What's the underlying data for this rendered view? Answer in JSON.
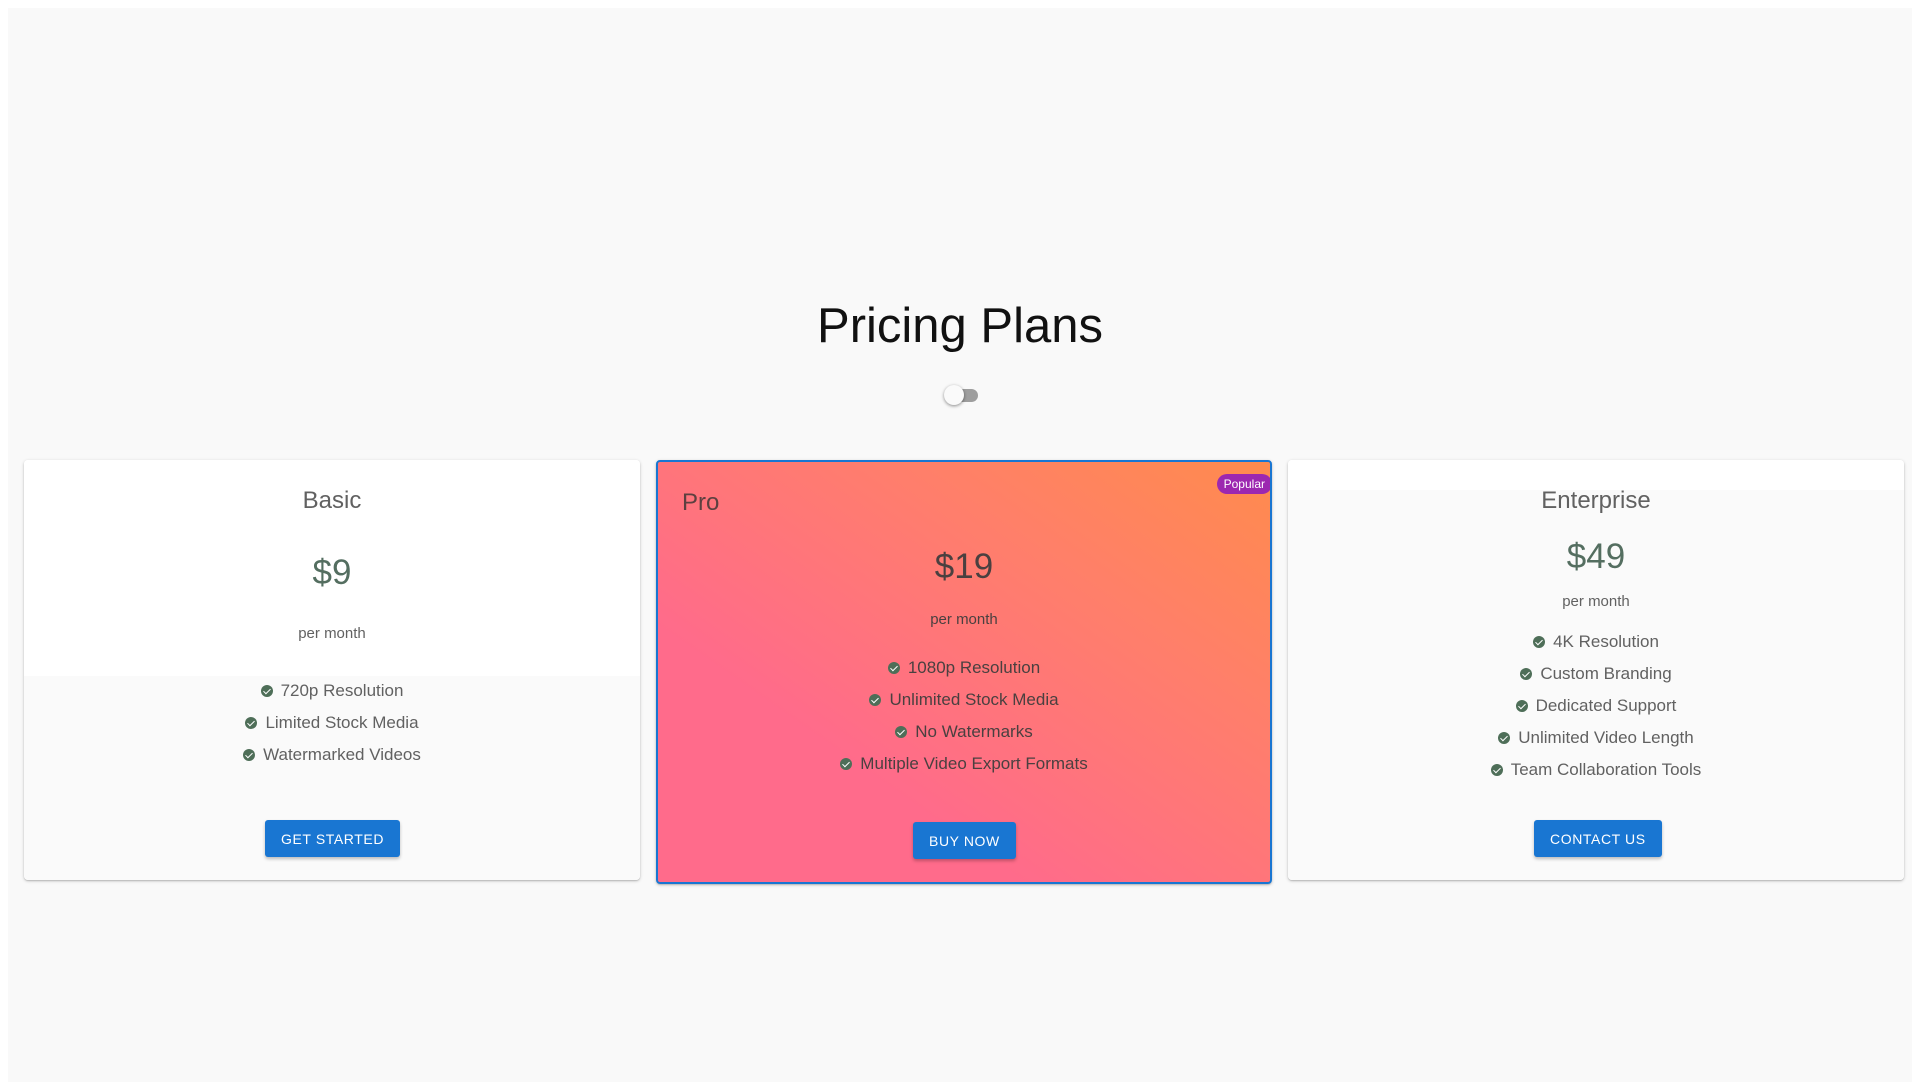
{
  "header": {
    "title": "Pricing Plans"
  },
  "billing_toggle": {
    "checked": false
  },
  "plans": [
    {
      "name": "Basic",
      "price": "$9",
      "period": "per month",
      "features": [
        "720p Resolution",
        "Limited Stock Media",
        "Watermarked Videos"
      ],
      "button_label": "GET STARTED"
    },
    {
      "name": "Pro",
      "price": "$19",
      "period": "per month",
      "badge": "Popular",
      "features": [
        "1080p Resolution",
        "Unlimited Stock Media",
        "No Watermarks",
        "Multiple Video Export Formats"
      ],
      "button_label": "BUY NOW"
    },
    {
      "name": "Enterprise",
      "price": "$49",
      "period": "per month",
      "features": [
        "4K Resolution",
        "Custom Branding",
        "Dedicated Support",
        "Unlimited Video Length",
        "Team Collaboration Tools"
      ],
      "button_label": "CONTACT US"
    }
  ],
  "colors": {
    "background": "#f9f9f9",
    "primary_button": "#1976d2",
    "highlight_border": "#1976d2",
    "badge": "#9c27b0",
    "pro_gradient_start": "#ff6b8b",
    "pro_gradient_end": "#ff8b4d",
    "check_icon": "#4e6e58"
  },
  "icons": {
    "feature_check": "check-circle-icon"
  }
}
